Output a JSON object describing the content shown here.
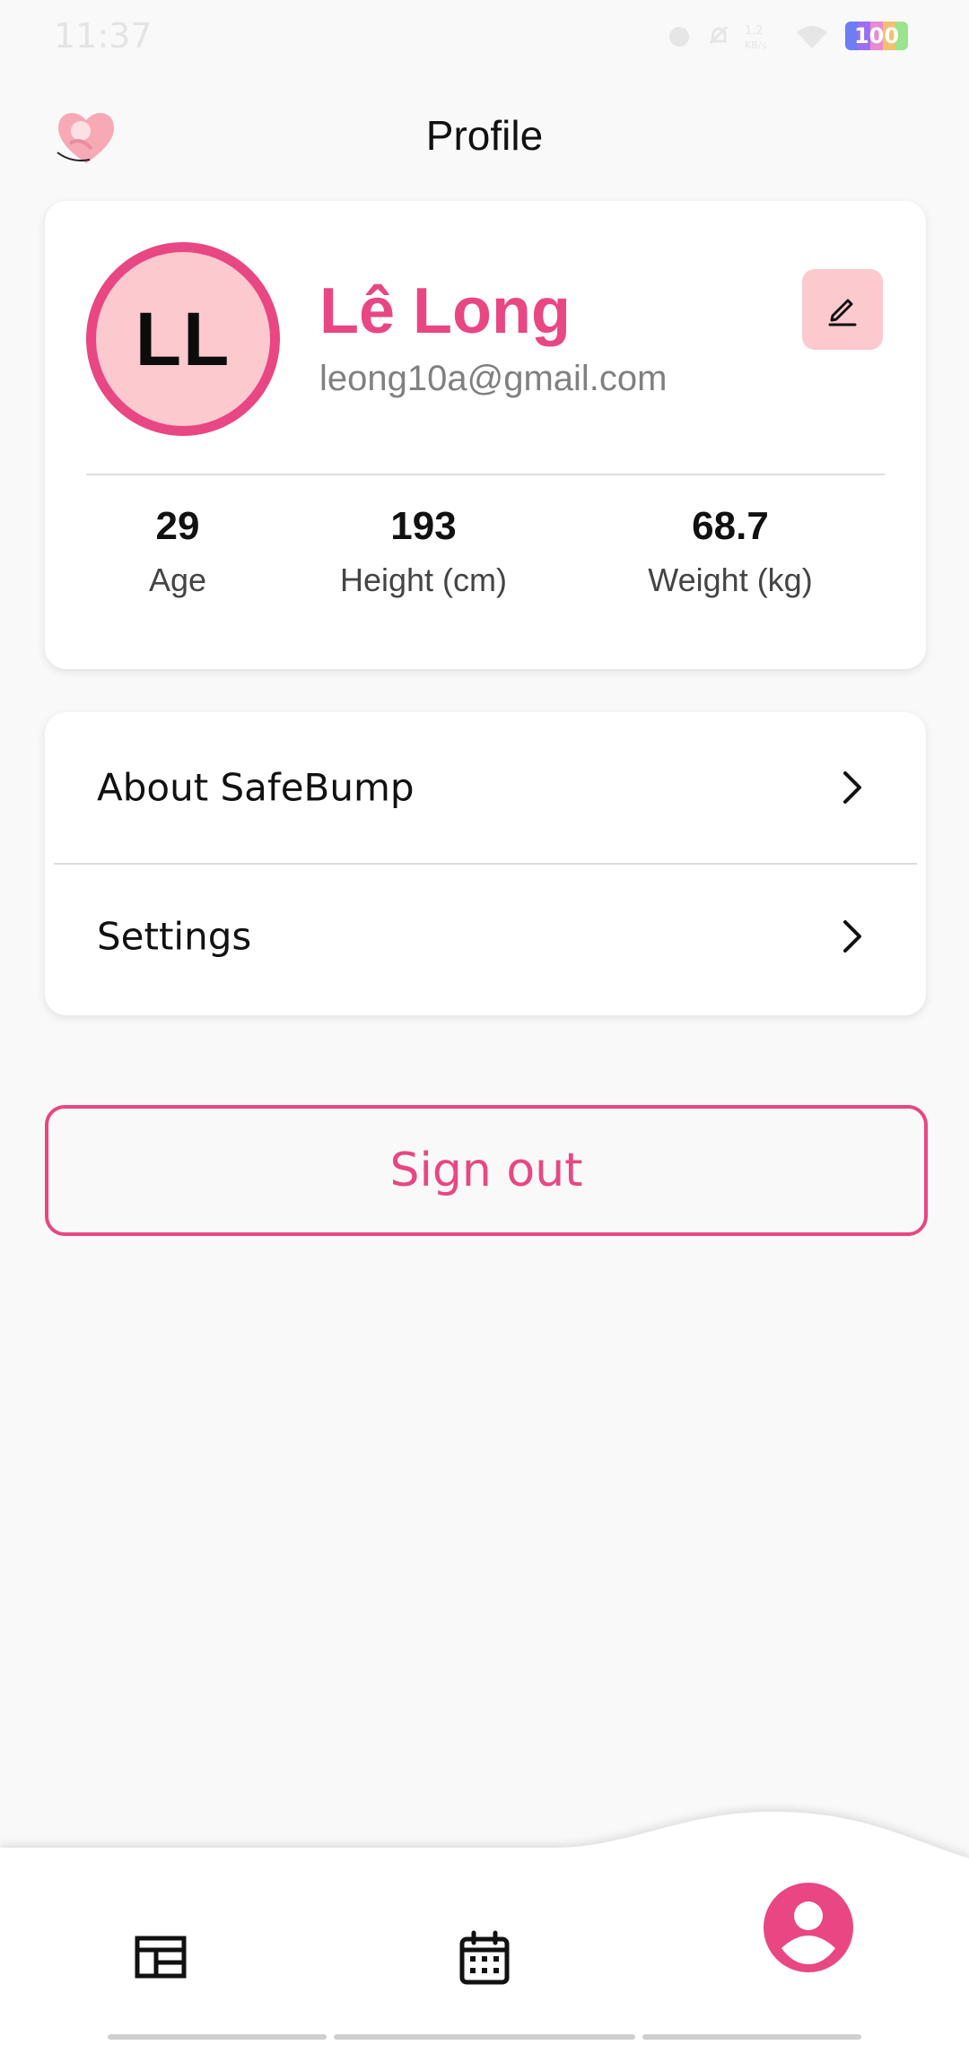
{
  "status_bar": {
    "time": "11:37",
    "battery": "100"
  },
  "header": {
    "title": "Profile"
  },
  "profile": {
    "initials": "LL",
    "name": "Lê Long",
    "email": "leong10a@gmail.com",
    "stats": [
      {
        "value": "29",
        "label": "Age"
      },
      {
        "value": "193",
        "label": "Height (cm)"
      },
      {
        "value": "68.7",
        "label": "Weight (kg)"
      }
    ]
  },
  "menu": {
    "items": [
      {
        "label": "About SafeBump"
      },
      {
        "label": "Settings"
      }
    ]
  },
  "actions": {
    "sign_out": "Sign out"
  },
  "bottom_nav": {
    "items": [
      {
        "icon": "dashboard-icon",
        "active": false
      },
      {
        "icon": "calendar-icon",
        "active": false
      },
      {
        "icon": "profile-icon",
        "active": true
      }
    ]
  },
  "colors": {
    "accent": "#e84783",
    "accent_light": "#fcc9cf",
    "background": "#f9f9f9"
  }
}
